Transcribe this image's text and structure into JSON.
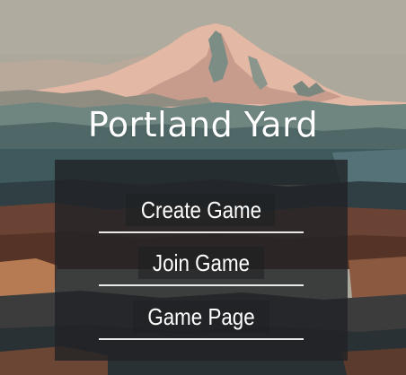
{
  "app": {
    "title": "Portland Yard"
  },
  "menu": {
    "items": [
      {
        "id": "create-game",
        "label": "Create Game"
      },
      {
        "id": "join-game",
        "label": "Join Game"
      },
      {
        "id": "game-page",
        "label": "Game Page"
      }
    ]
  },
  "colors": {
    "title_text": "#ffffff",
    "menu_text": "#ffffff",
    "menu_underline": "#e9e9e9",
    "panel_overlay": "rgba(32, 34, 38, 0.80)",
    "sky": "#aca89c",
    "mountain_snow": "#e3b8a4",
    "forest": "#6f8680"
  }
}
